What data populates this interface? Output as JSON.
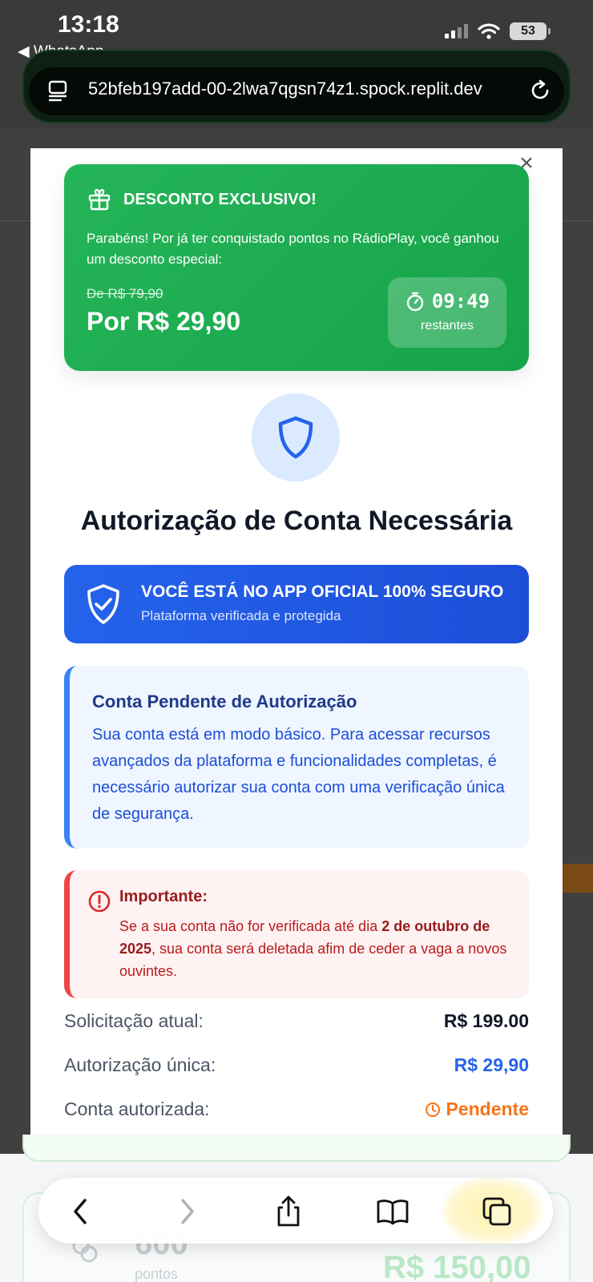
{
  "status_bar": {
    "time": "13:18",
    "back_app": "◀ WhatsApp",
    "battery": "53"
  },
  "browser": {
    "url": "52bfeb197add-00-2lwa7qgsn74z1.spock.replit.dev"
  },
  "modal": {
    "close": "×",
    "promo": {
      "title": "DESCONTO EXCLUSIVO!",
      "description": "Parabéns! Por já ter conquistado pontos no RádioPlay, você ganhou um desconto especial:",
      "old_price": "De R$ 79,90",
      "new_price": "Por R$ 29,90",
      "timer": "09:49",
      "timer_label": "restantes"
    },
    "title": "Autorização de Conta Necessária",
    "secure_banner": {
      "title": "VOCÊ ESTÁ NO APP OFICIAL 100% SEGURO",
      "subtitle": "Plataforma verificada e protegida"
    },
    "info_box": {
      "title": "Conta Pendente de Autorização",
      "text": "Sua conta está em modo básico. Para acessar recursos avançados da plataforma e funcionalidades completas, é necessário autorizar sua conta com uma verificação única de segurança."
    },
    "warning": {
      "title": "Importante:",
      "text_before": "Se a sua conta não for verificada até dia ",
      "date": "2 de outubro de 2025",
      "text_after": ", sua conta será deletada afim de ceder a vaga a novos ouvintes."
    },
    "summary": [
      {
        "label": "Solicitação atual:",
        "value": "R$ 199.00"
      },
      {
        "label": "Autorização única:",
        "value": "R$ 29,90"
      },
      {
        "label": "Conta autorizada:",
        "value": "Pendente"
      }
    ]
  },
  "background_peek": {
    "points": "600",
    "points_label": "pontos",
    "price": "R$ 150,00"
  },
  "colors": {
    "promo_green": "#16a34a",
    "brand_blue": "#2563eb",
    "warning_red": "#ef4444",
    "pending_orange": "#f97316"
  },
  "icons": [
    "gift-icon",
    "stopwatch-icon",
    "shield-icon",
    "shield-check-icon",
    "alert-circle-icon",
    "clock-icon",
    "back-chevron-icon",
    "forward-chevron-icon",
    "share-icon",
    "bookmarks-icon",
    "tabs-icon",
    "reader-icon",
    "reload-icon"
  ]
}
